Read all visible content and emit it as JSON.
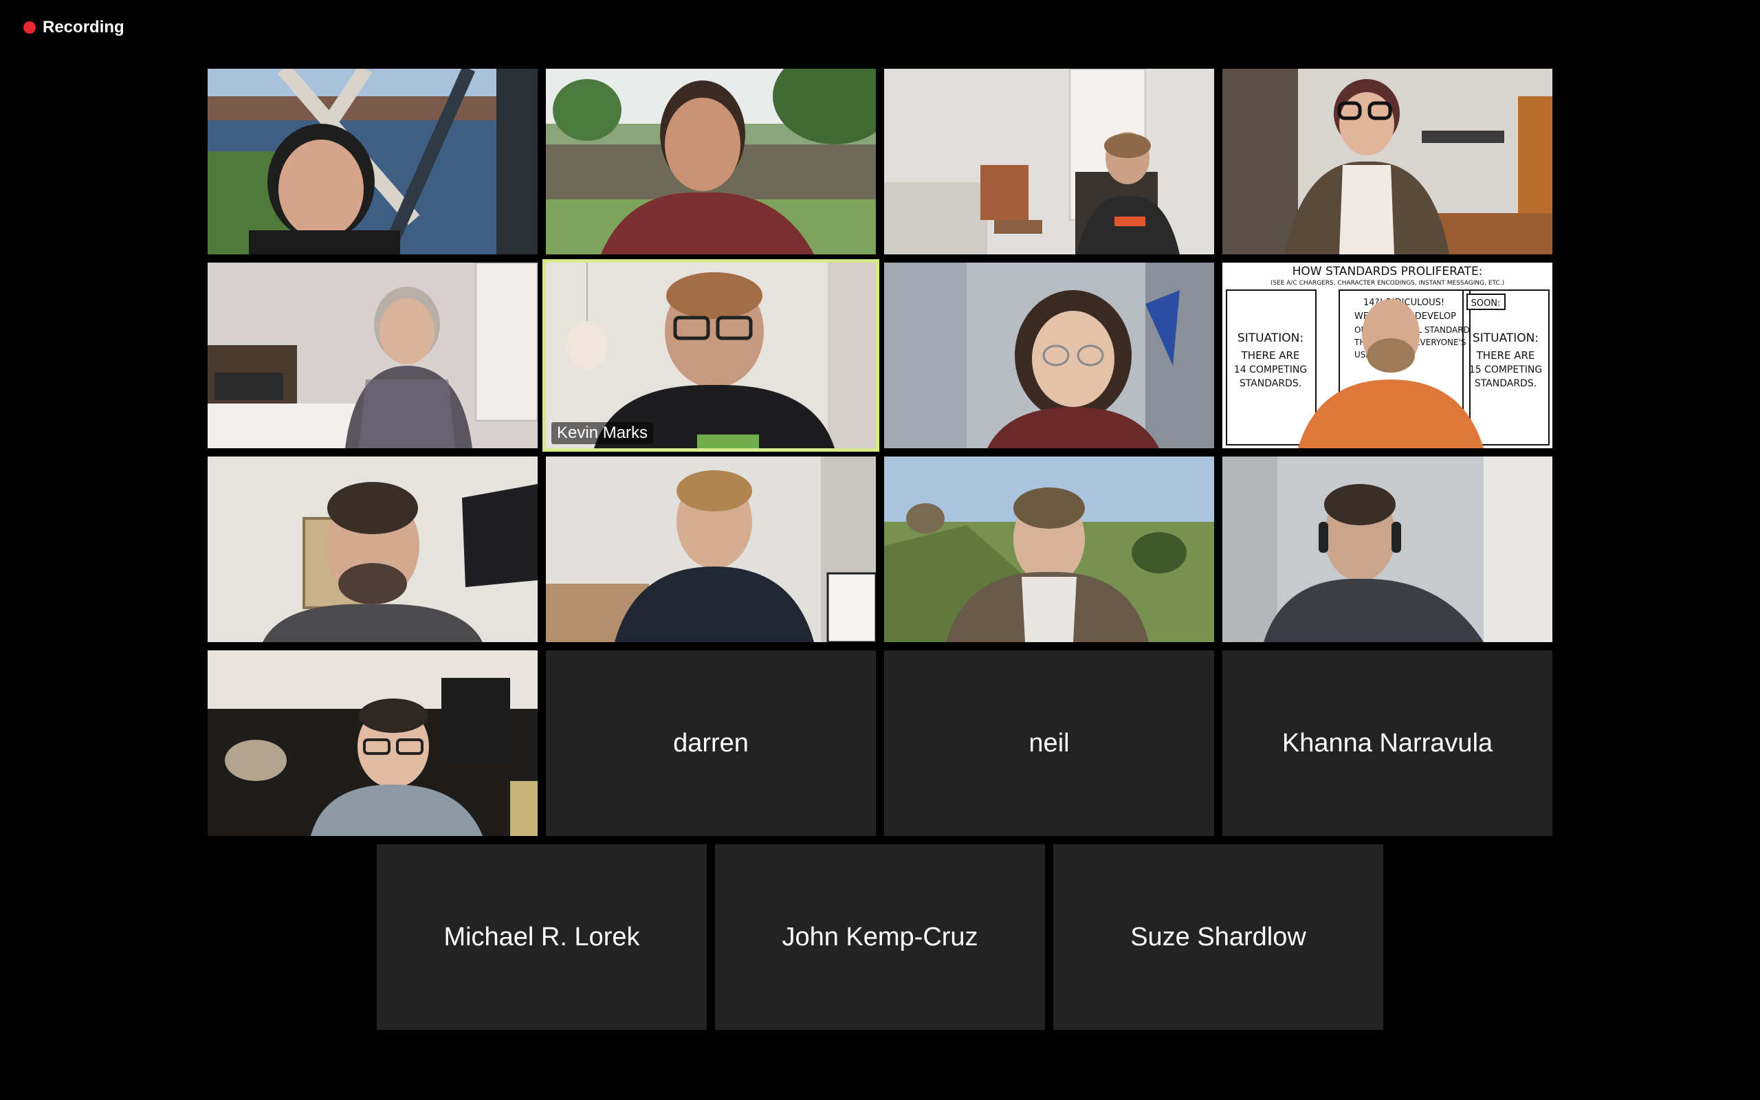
{
  "status": {
    "recording_label": "Recording",
    "recording_color": "#e8282e"
  },
  "participants": [
    {
      "name": "",
      "video": "on",
      "scene": "outdoor-lake-lattice"
    },
    {
      "name": "",
      "video": "on",
      "scene": "festival-crowd"
    },
    {
      "name": "",
      "video": "on",
      "scene": "living-room-white"
    },
    {
      "name": "",
      "video": "on",
      "scene": "room-with-piano"
    },
    {
      "name": "",
      "video": "on",
      "scene": "office-desk"
    },
    {
      "name": "Kevin Marks",
      "video": "on",
      "scene": "bright-room",
      "active_speaker": true
    },
    {
      "name": "",
      "video": "on",
      "scene": "blue-grey-room"
    },
    {
      "name": "",
      "video": "on",
      "scene": "comic-strip-background"
    },
    {
      "name": "",
      "video": "on",
      "scene": "white-wall-tv"
    },
    {
      "name": "",
      "video": "on",
      "scene": "kitchen"
    },
    {
      "name": "",
      "video": "on",
      "scene": "green-hills"
    },
    {
      "name": "",
      "video": "on",
      "scene": "grey-wall"
    },
    {
      "name": "",
      "video": "on",
      "scene": "leather-sofa"
    },
    {
      "name": "darren",
      "video": "off"
    },
    {
      "name": "neil",
      "video": "off"
    },
    {
      "name": "Khanna Narravula",
      "video": "off"
    },
    {
      "name": "Michael R. Lorek",
      "video": "off"
    },
    {
      "name": "John Kemp-Cruz",
      "video": "off"
    },
    {
      "name": "Suze Shardlow",
      "video": "off"
    }
  ],
  "comic": {
    "title": "HOW STANDARDS PROLIFERATE:",
    "subtitle": "(SEE A/C CHARGERS, CHARACTER ENCODINGS, INSTANT MESSAGING, ETC.)",
    "panel1": [
      "SITUATION:",
      "THERE ARE",
      "14 COMPETING",
      "STANDARDS."
    ],
    "panel2": [
      "14?! RIDICULOUS!",
      "WE NEED TO DEVELOP",
      "ONE UNIVERSAL STANDARD",
      "THAT COVERS EVERYONE'S",
      "USE CASES."
    ],
    "panel3_tag": "SOON:",
    "panel3": [
      "SITUATION:",
      "THERE ARE",
      "15 COMPETING",
      "STANDARDS."
    ]
  },
  "colors": {
    "tile_empty": "#232323",
    "active_border": "#d6ea8a",
    "background": "#000000"
  }
}
